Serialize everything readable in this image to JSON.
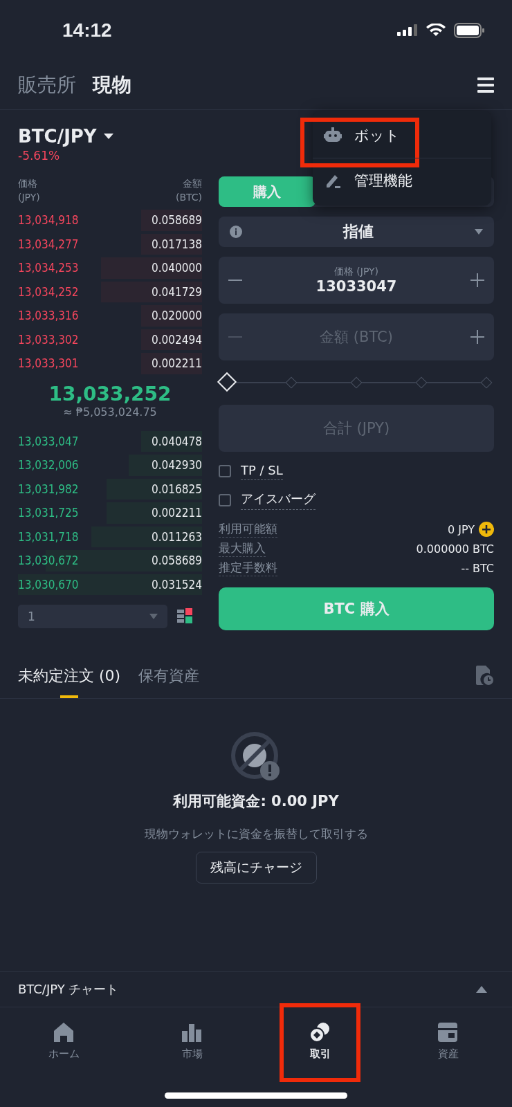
{
  "status_bar": {
    "time": "14:12"
  },
  "top_tabs": [
    {
      "label": "販売所",
      "selected": false
    },
    {
      "label": "現物",
      "selected": true
    }
  ],
  "menu": {
    "items": [
      {
        "label": "ボット",
        "kind": "bot",
        "highlighted": true
      },
      {
        "label": "管理機能",
        "kind": "manage",
        "highlighted": false
      }
    ]
  },
  "pair": {
    "symbol": "BTC/JPY",
    "change": "-5.61%"
  },
  "order_book": {
    "headers": [
      {
        "label": "価格",
        "unit": "(JPY)"
      },
      {
        "label": "金額",
        "unit": "(BTC)"
      }
    ],
    "asks": [
      {
        "price": "13,034,918",
        "amount": "0.058689"
      },
      {
        "price": "13,034,277",
        "amount": "0.017138"
      },
      {
        "price": "13,034,253",
        "amount": "0.040000"
      },
      {
        "price": "13,034,252",
        "amount": "0.041729"
      },
      {
        "price": "13,033,316",
        "amount": "0.020000"
      },
      {
        "price": "13,033,302",
        "amount": "0.002494"
      },
      {
        "price": "13,033,301",
        "amount": "0.002211"
      }
    ],
    "last_price": "13,033,252",
    "converted": "≈ ₱5,053,024.75",
    "bids": [
      {
        "price": "13,033,047",
        "amount": "0.040478"
      },
      {
        "price": "13,032,006",
        "amount": "0.042930"
      },
      {
        "price": "13,031,982",
        "amount": "0.016825"
      },
      {
        "price": "13,031,725",
        "amount": "0.002211"
      },
      {
        "price": "13,031,718",
        "amount": "0.011263"
      },
      {
        "price": "13,030,672",
        "amount": "0.058689"
      },
      {
        "price": "13,030,670",
        "amount": "0.031524"
      }
    ],
    "depth_select": "1"
  },
  "order_form": {
    "side_tabs": [
      {
        "label": "購入",
        "selected": true
      }
    ],
    "order_type": "指値",
    "price_field": {
      "label": "価格 (JPY)",
      "value": "13033047"
    },
    "amount_field": {
      "placeholder": "金額 (BTC)"
    },
    "slider": {
      "level": 0
    },
    "total_field": {
      "placeholder": "合計 (JPY)"
    },
    "options": [
      {
        "label": "TP / SL",
        "checked": false
      },
      {
        "label": "アイスバーグ",
        "checked": false
      }
    ],
    "info": [
      {
        "label": "利用可能額",
        "value": "0 JPY",
        "add": true
      },
      {
        "label": "最大購入",
        "value": "0.000000 BTC",
        "add": false
      },
      {
        "label": "推定手数料",
        "value": "-- BTC",
        "add": false
      }
    ],
    "submit": "BTC 購入"
  },
  "bottom_tabs": [
    {
      "label": "未約定注文 (0)",
      "selected": true
    },
    {
      "label": "保有資産",
      "selected": false
    }
  ],
  "empty_state": {
    "title": "利用可能資金: 0.00 JPY",
    "message": "現物ウォレットに資金を振替して取引する",
    "button": "残高にチャージ"
  },
  "chart_bar": {
    "label": "BTC/JPY チャート"
  },
  "nav": [
    {
      "label": "ホーム",
      "kind": "home",
      "selected": false,
      "highlighted": false
    },
    {
      "label": "市場",
      "kind": "market",
      "selected": false,
      "highlighted": false
    },
    {
      "label": "取引",
      "kind": "trade",
      "selected": true,
      "highlighted": true
    },
    {
      "label": "資産",
      "kind": "assets",
      "selected": false,
      "highlighted": false
    }
  ]
}
